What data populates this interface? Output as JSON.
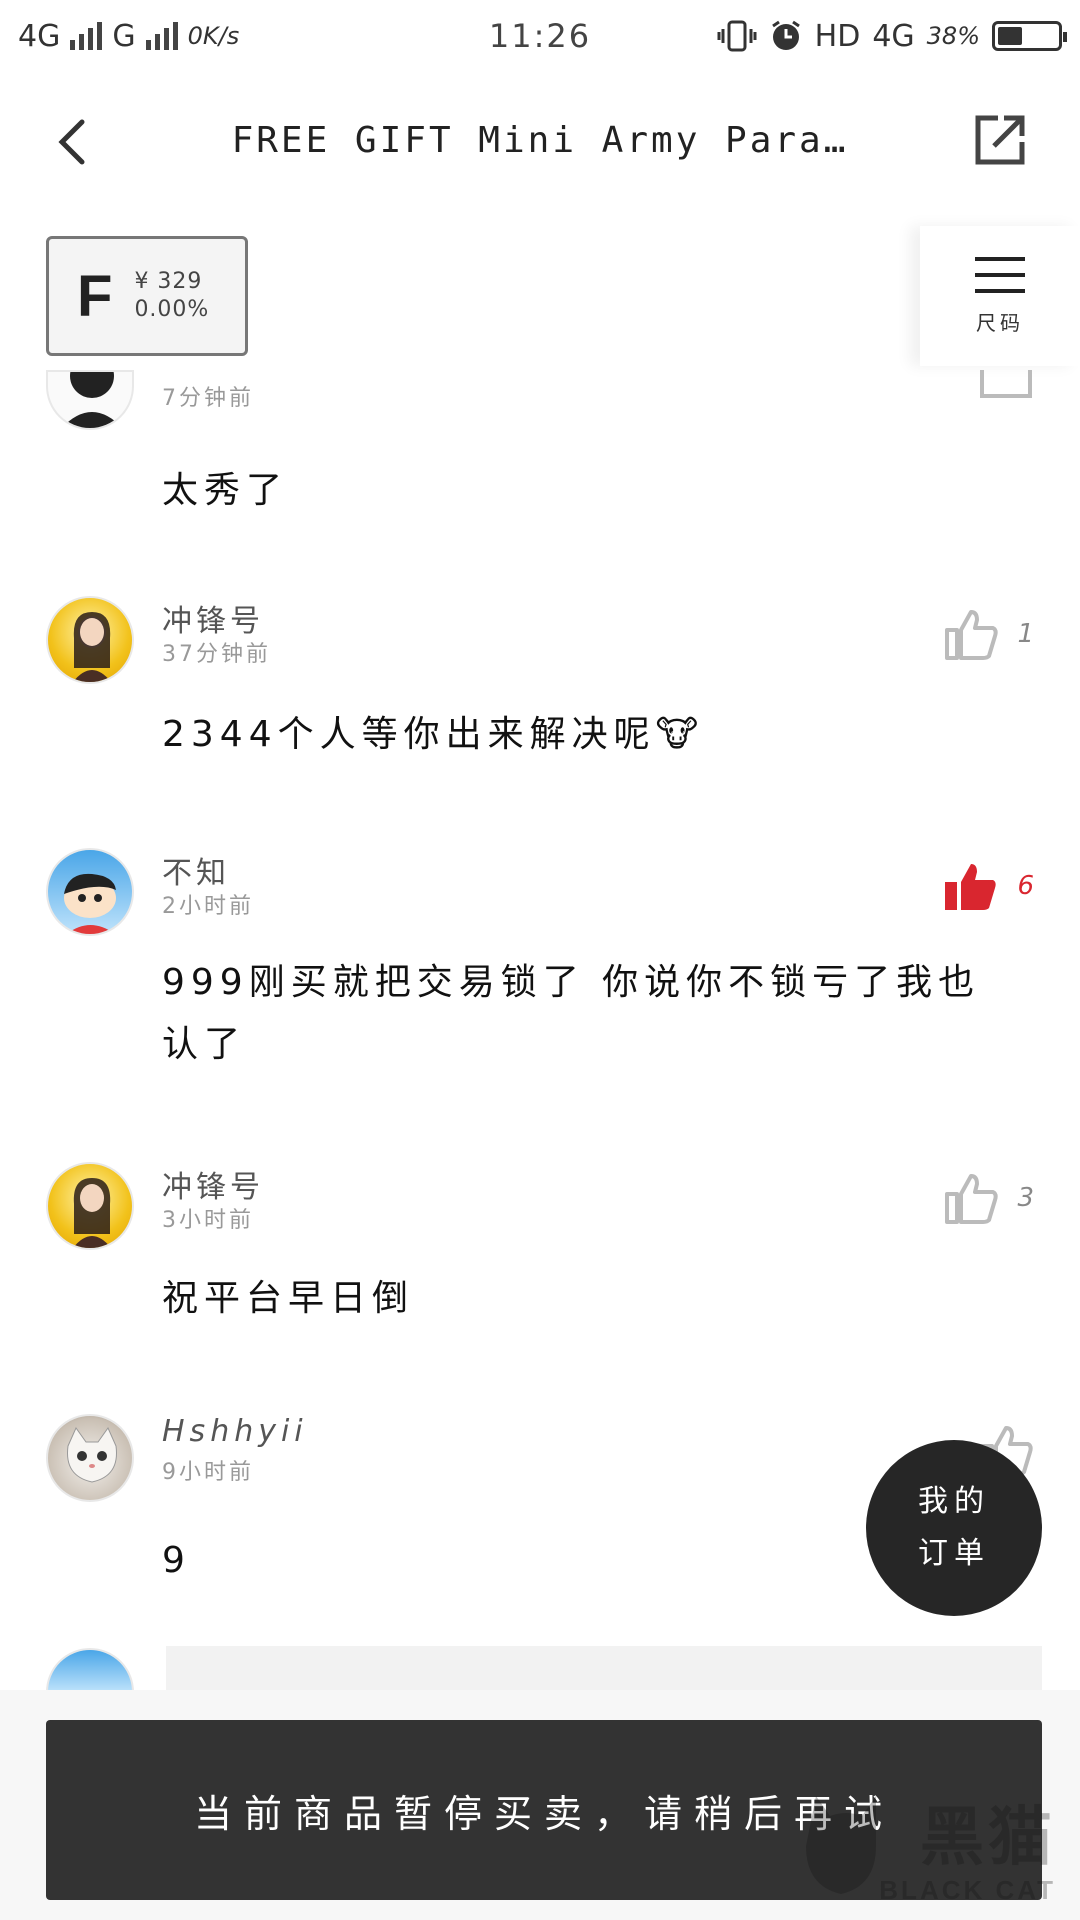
{
  "status_bar": {
    "network_1": "4G",
    "network_2": "G",
    "speed": "0K/s",
    "time": "11:26",
    "hd": "HD",
    "network_3": "4G",
    "battery": "38%"
  },
  "nav": {
    "title": "FREE GIFT Mini Army Para…"
  },
  "price_box": {
    "letter": "F",
    "price": "¥ 329",
    "change": "0.00%"
  },
  "size_panel": {
    "label": "尺码"
  },
  "comments": [
    {
      "name": "",
      "time": "7分钟前",
      "text": "太秀了",
      "likes": ""
    },
    {
      "name": "冲锋号",
      "time": "37分钟前",
      "text": "2344个人等你出来解决呢🐮",
      "likes": "1"
    },
    {
      "name": "不知",
      "time": "2小时前",
      "text": "999刚买就把交易锁了 你说你不锁亏了我也认了",
      "likes": "6"
    },
    {
      "name": "冲锋号",
      "time": "3小时前",
      "text": "祝平台早日倒",
      "likes": "3"
    },
    {
      "name": "Hshhyii",
      "time": "9小时前",
      "text": "9",
      "likes": ""
    }
  ],
  "fab": {
    "line1": "我的",
    "line2": "订单"
  },
  "notice": {
    "text": "当前商品暂停买卖，请稍后再试"
  },
  "watermark": {
    "cn": "黑猫",
    "en": "BLACK CAT"
  },
  "colors": {
    "accent_red": "#d9262f",
    "dark": "#333333"
  }
}
